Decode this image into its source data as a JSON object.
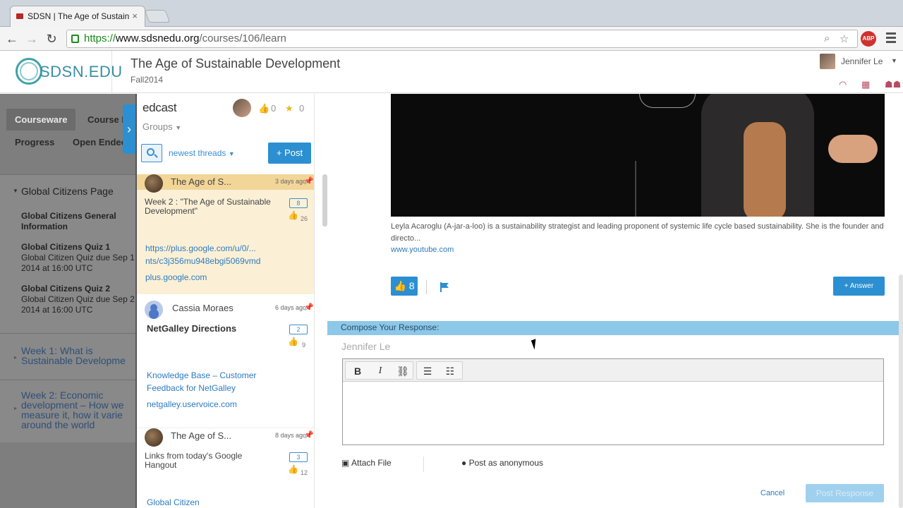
{
  "browser": {
    "tab_title": "SDSN | The Age of Sustain",
    "tab_close": "×",
    "url_scheme": "https://",
    "url_host": "www.sdsnedu.org",
    "url_path": "/courses/106/learn",
    "abp_label": "ABP"
  },
  "site": {
    "logo_text": "SDSN.EDU",
    "course_title": "The Age of Sustainable Development",
    "course_term": "Fall2014",
    "user_name": "Jennifer Le"
  },
  "courseware": {
    "tabs": [
      "Courseware",
      "Course I",
      "Progress",
      "Open Endec"
    ],
    "section_heading": "Global Citizens Page",
    "items": [
      {
        "title": "Global Citizens General Information",
        "sub": ""
      },
      {
        "title": "Global Citizens Quiz 1",
        "sub": "Global Citizen Quiz due Sep 1 2014 at 16:00 UTC"
      },
      {
        "title": "Global Citizens Quiz 2",
        "sub": "Global Citizen Quiz due Sep 2 2014 at 16:00 UTC"
      }
    ],
    "links": [
      "Week 1: What is Sustainable Developme",
      "Week 2: Economic development – How we measure it, how it varie around the world"
    ]
  },
  "discussion": {
    "brand": "edcast",
    "likes": "0",
    "stars": "0",
    "groups_label": "Groups",
    "sort_label": "newest threads",
    "post_label": "+ Post",
    "threads": [
      {
        "author": "The Age of S...",
        "time": "3 days ago",
        "title": "Week 2 : \"The Age of Sustainable Development\"",
        "count": "8",
        "likes": "26",
        "links": [
          "https://plus.google.com/u/0/...",
          "nts/c3j356mu948ebgi5069vmd",
          "plus.google.com"
        ]
      },
      {
        "author": "Cassia Moraes",
        "time": "6 days ago",
        "title": "NetGalley Directions",
        "count": "2",
        "likes": "9",
        "links": [
          "Knowledge Base – Customer Feedback for NetGalley",
          "netgalley.uservoice.com"
        ]
      },
      {
        "author": "The Age of S...",
        "time": "8 days ago",
        "title": "Links from today's Google Hangout",
        "count": "3",
        "likes": "12",
        "links": [
          "Global Citizen"
        ]
      }
    ]
  },
  "post": {
    "description": "Leyla Acaroglu (A-jar-a-loo) is a sustainability strategist and leading proponent of systemic life cycle based sustainability. She is the founder and directo...",
    "source_link": "www.youtube.com",
    "like_count": "8",
    "answer_label": "+ Answer"
  },
  "compose": {
    "bar_label": "Compose Your Response:",
    "author": "Jennifer Le",
    "bold": "B",
    "italic": "I",
    "attach_label": "Attach File",
    "anon_label": "Post as anonymous",
    "cancel_label": "Cancel",
    "submit_label": "Post Response"
  },
  "colors": {
    "accent": "#2b8fd1",
    "selected_thread": "#fbf0d6",
    "compose_bar": "#8dc8e8"
  }
}
